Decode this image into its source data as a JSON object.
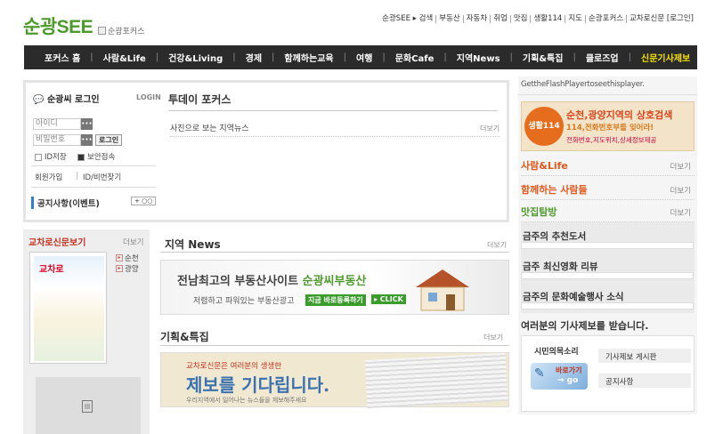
{
  "header": {
    "logo": "순광SEE",
    "logo_alt": "순광포커스",
    "top_links": [
      "순광SEE ▸ 검색",
      "부동산",
      "자동차",
      "취업",
      "맛집",
      "생활114",
      "지도",
      "순광포커스",
      "교차로신문 [로그인]"
    ]
  },
  "gnb": {
    "items": [
      "포커스 홈",
      "사람&Life",
      "건강&Living",
      "경제",
      "함께하는교육",
      "여행",
      "문화Cafe",
      "지역News",
      "기획&특집",
      "클로즈업"
    ],
    "highlight": "신문기사제보"
  },
  "login": {
    "title": "순광씨 로그인",
    "title_en": "LOGIN",
    "id_placeholder": "아이디",
    "pw_placeholder": "비밀번호",
    "button": "로그인",
    "save_id": "ID저장",
    "secure": "보안접속",
    "join": "회원가입",
    "find": "ID/비번찾기"
  },
  "notice": {
    "title": "공지사항(이벤트)",
    "button": "+ ○○"
  },
  "today": {
    "title": "투데이 포커스",
    "item": "사진으로 보는 지역뉴스",
    "more": "더보기"
  },
  "right": {
    "flash": "GettheFlashPlayertoseethisplayer.",
    "banner": {
      "badge": "생활114",
      "line1": "순천,광양지역의 상호검색",
      "line2": "114,전화번호부를 잊어라!",
      "line3": "전화번호,지도위치,상세정보제공"
    },
    "sections": [
      {
        "title": "사람&Life",
        "more": "더보기",
        "color": "#e2581c"
      },
      {
        "title": "함께하는 사람들",
        "more": "더보기",
        "color": "#e2581c"
      },
      {
        "title": "맛집탐방",
        "more": "더보기",
        "color": "#4f9a2d"
      }
    ],
    "lists": [
      "금주의 추천도서",
      "금주 최신영화 리뷰",
      "금주의 문화예술행사 소식"
    ],
    "tip_title": "여러분의 기사제보를 받습니다.",
    "tip": {
      "voice": "시민의목소리",
      "go": "바로가기",
      "go_en": "→ go",
      "board": "기사제보 게시판",
      "notice": "공지사항"
    }
  },
  "paper": {
    "title": "교차로신문보기",
    "more": "더보기",
    "links": [
      "순천",
      "광양"
    ],
    "head": "교차로"
  },
  "local": {
    "title": "지역 News",
    "more": "더보기"
  },
  "ad1": {
    "text1": "전남최고의 부동산사이트 ",
    "text1b": "순광씨부동산",
    "text2": "저렴하고 파워있는 부동산광고",
    "btn": "지금 바로등록하기",
    "btn2": "▸ CLICK"
  },
  "special": {
    "title": "기획&특집",
    "more": "더보기"
  },
  "ad2": {
    "t1": "교차로신문은 여러분의 생생한",
    "t2": "제보를 기다립니다.",
    "t3": "우리지역에서 일어나는 뉴스들을 제보해주세요"
  }
}
